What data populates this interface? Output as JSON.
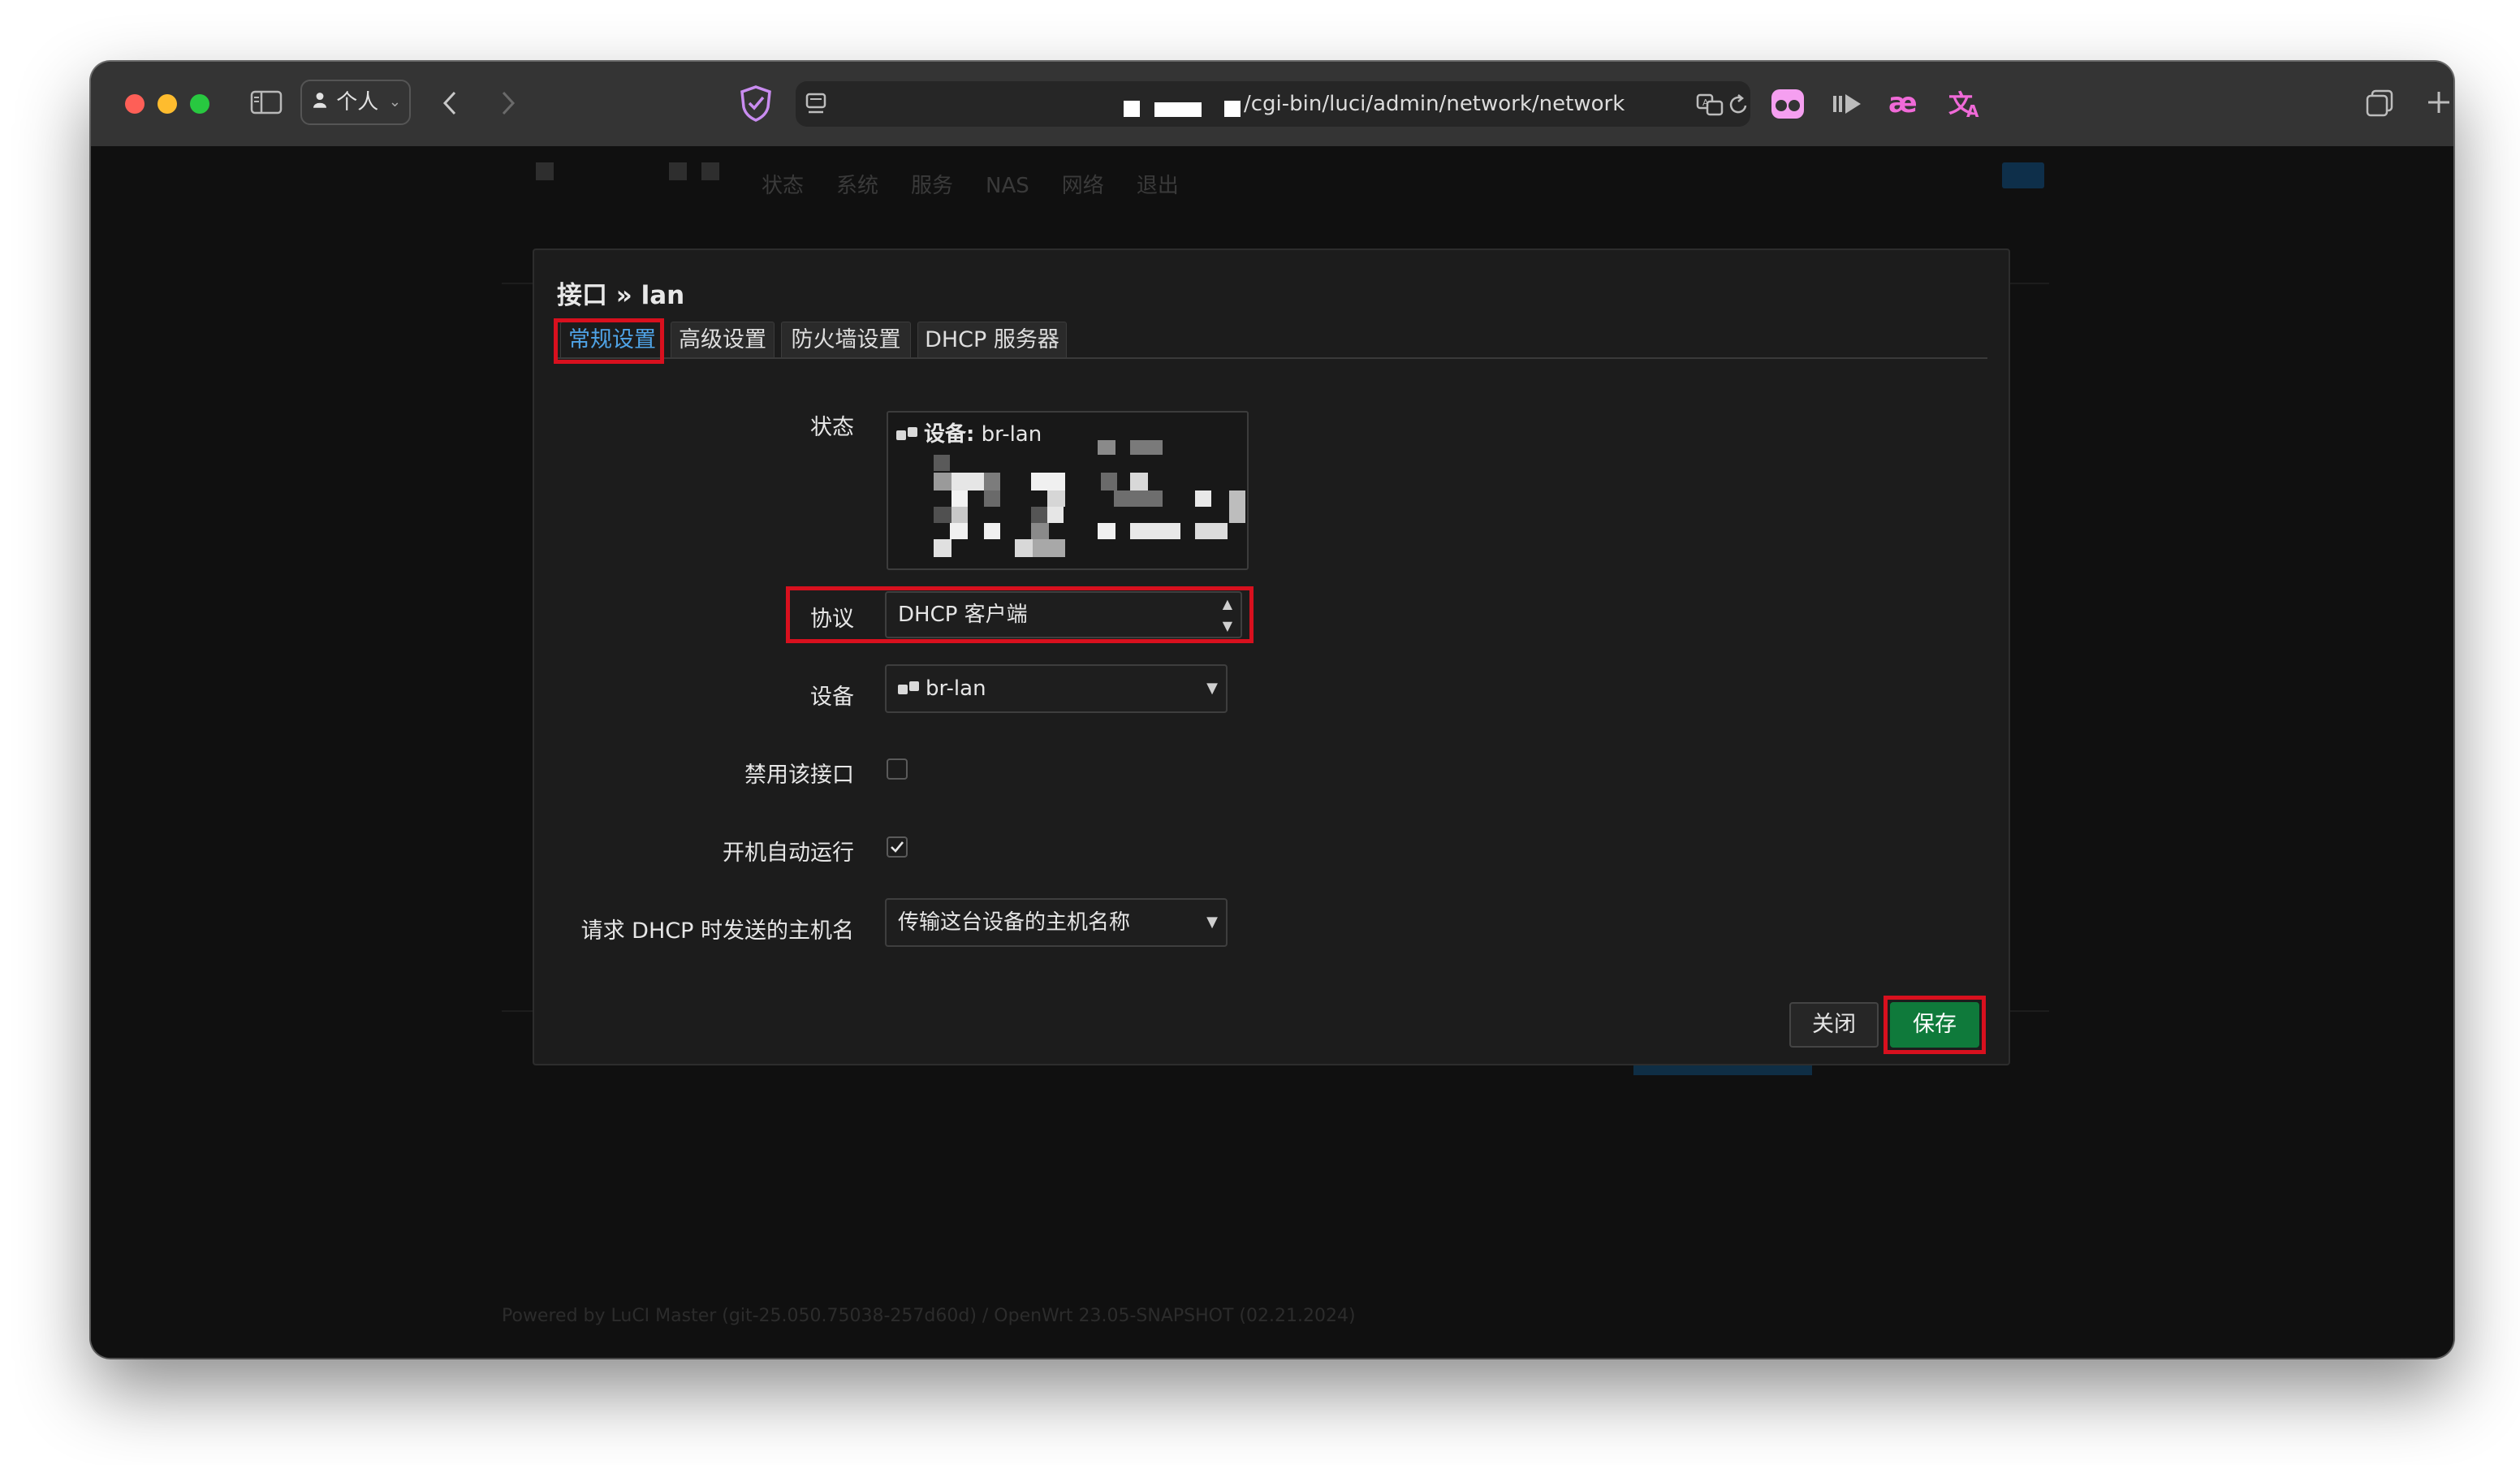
{
  "browser": {
    "profile_label": "个人",
    "url": "/cgi-bin/luci/admin/network/network"
  },
  "background": {
    "nav": [
      "状态",
      "系统",
      "服务",
      "NAS",
      "网络",
      "退出"
    ],
    "footer": "Powered by LuCI Master (git-25.050.75038-257d60d) / OpenWrt 23.05-SNAPSHOT (02.21.2024)"
  },
  "modal": {
    "title": "接口 » lan",
    "tabs": [
      {
        "label": "常规设置",
        "active": true
      },
      {
        "label": "高级设置",
        "active": false
      },
      {
        "label": "防火墙设置",
        "active": false
      },
      {
        "label": "DHCP 服务器",
        "active": false
      }
    ],
    "status": {
      "label": "状态",
      "device_prefix": "设备:",
      "device_name": "br-lan"
    },
    "protocol": {
      "label": "协议",
      "value": "DHCP 客户端"
    },
    "device": {
      "label": "设备",
      "value": "br-lan"
    },
    "disable": {
      "label": "禁用该接口",
      "checked": false
    },
    "autostart": {
      "label": "开机自动运行",
      "checked": true
    },
    "hostname": {
      "label": "请求 DHCP 时发送的主机名",
      "value": "传输这台设备的主机名称"
    },
    "buttons": {
      "close": "关闭",
      "save": "保存"
    }
  },
  "colors": {
    "highlight": "#d8101e",
    "save": "#0f7a3b",
    "active_tab": "#4fa3e6"
  }
}
